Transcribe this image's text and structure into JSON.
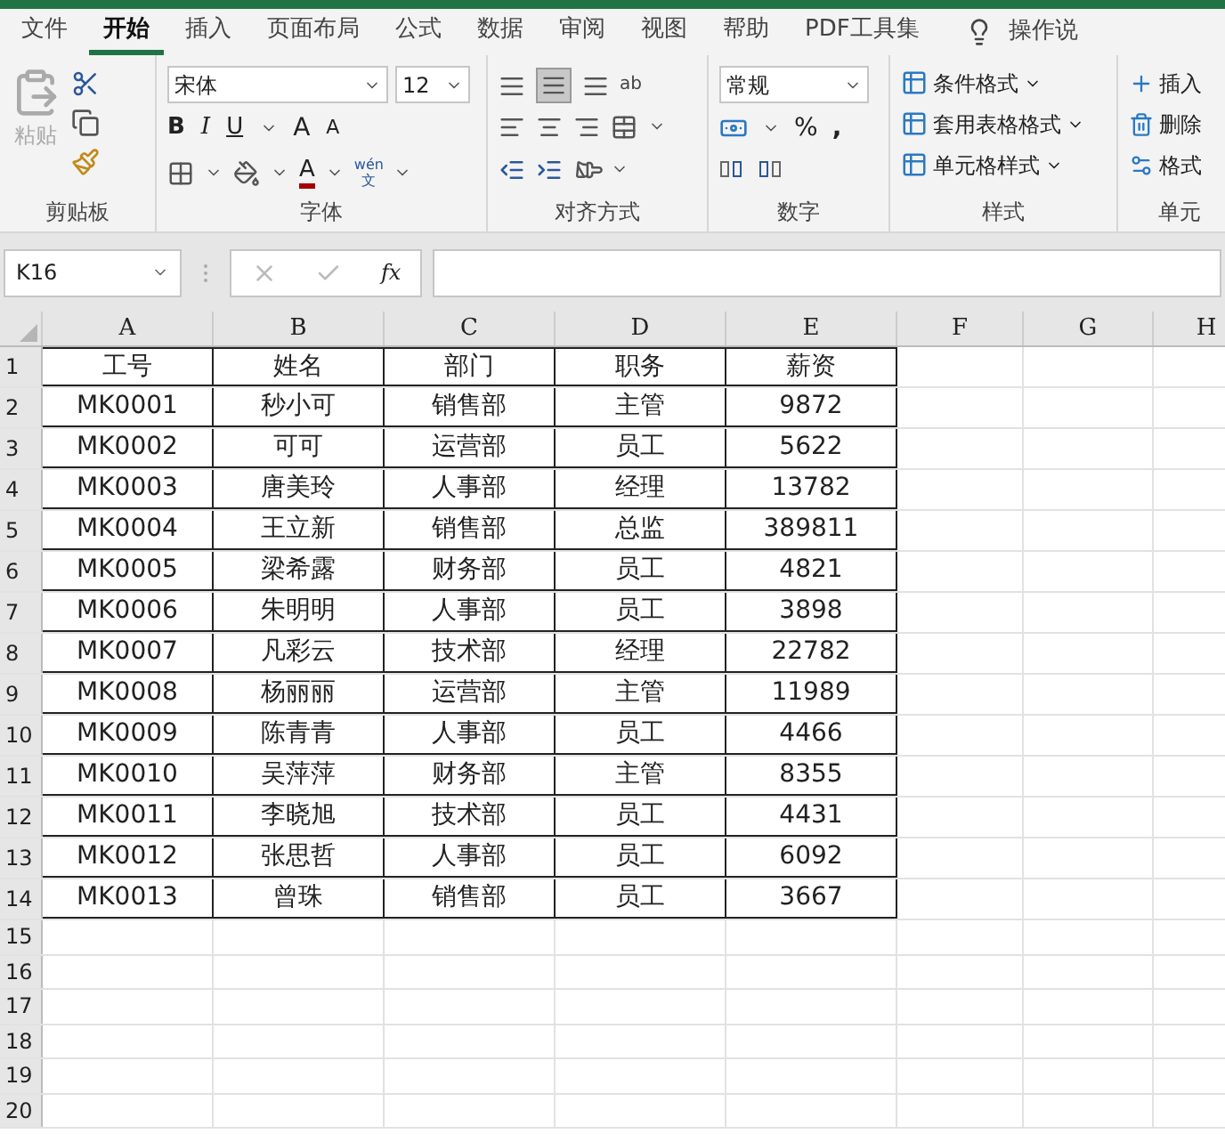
{
  "tabs": [
    {
      "label": "文件",
      "selected": false
    },
    {
      "label": "开始",
      "selected": true
    },
    {
      "label": "插入",
      "selected": false
    },
    {
      "label": "页面布局",
      "selected": false
    },
    {
      "label": "公式",
      "selected": false
    },
    {
      "label": "数据",
      "selected": false
    },
    {
      "label": "审阅",
      "selected": false
    },
    {
      "label": "视图",
      "selected": false
    },
    {
      "label": "帮助",
      "selected": false
    },
    {
      "label": "PDF工具集",
      "selected": false
    }
  ],
  "tell_me": "操作说",
  "ribbon": {
    "clipboard": {
      "paste": "粘贴",
      "label": "剪贴板"
    },
    "font": {
      "font_name": "宋体",
      "font_size": "12",
      "bold": "B",
      "italic": "I",
      "underline": "U",
      "grow": "A",
      "shrink": "A",
      "font_color": "A",
      "phonetic_top": "wén",
      "phonetic_bottom": "文",
      "label": "字体"
    },
    "alignment": {
      "wrap": "ab",
      "label": "对齐方式"
    },
    "number": {
      "format": "常规",
      "percent": "%",
      "comma": ",",
      "label": "数字"
    },
    "styles": {
      "items": [
        "条件格式",
        "套用表格格式",
        "单元格样式"
      ],
      "label": "样式"
    },
    "cells": {
      "items": [
        "插入",
        "删除",
        "格式"
      ],
      "label": "单元"
    }
  },
  "formula_bar": {
    "name_box": "K16",
    "fx": "fx"
  },
  "columns": [
    "A",
    "B",
    "C",
    "D",
    "E",
    "F",
    "G",
    "H"
  ],
  "row_numbers": [
    "1",
    "2",
    "3",
    "4",
    "5",
    "6",
    "7",
    "8",
    "9",
    "10",
    "11",
    "12",
    "13",
    "14",
    "15",
    "16",
    "17",
    "18",
    "19",
    "20"
  ],
  "table": [
    [
      "工号",
      "姓名",
      "部门",
      "职务",
      "薪资"
    ],
    [
      "MK0001",
      "秒小可",
      "销售部",
      "主管",
      "9872"
    ],
    [
      "MK0002",
      "可可",
      "运营部",
      "员工",
      "5622"
    ],
    [
      "MK0003",
      "唐美玲",
      "人事部",
      "经理",
      "13782"
    ],
    [
      "MK0004",
      "王立新",
      "销售部",
      "总监",
      "389811"
    ],
    [
      "MK0005",
      "梁希露",
      "财务部",
      "员工",
      "4821"
    ],
    [
      "MK0006",
      "朱明明",
      "人事部",
      "员工",
      "3898"
    ],
    [
      "MK0007",
      "凡彩云",
      "技术部",
      "经理",
      "22782"
    ],
    [
      "MK0008",
      "杨丽丽",
      "运营部",
      "主管",
      "11989"
    ],
    [
      "MK0009",
      "陈青青",
      "人事部",
      "员工",
      "4466"
    ],
    [
      "MK0010",
      "吴萍萍",
      "财务部",
      "主管",
      "8355"
    ],
    [
      "MK0011",
      "李晓旭",
      "技术部",
      "员工",
      "4431"
    ],
    [
      "MK0012",
      "张思哲",
      "人事部",
      "员工",
      "6092"
    ],
    [
      "MK0013",
      "曾珠",
      "销售部",
      "员工",
      "3667"
    ]
  ]
}
